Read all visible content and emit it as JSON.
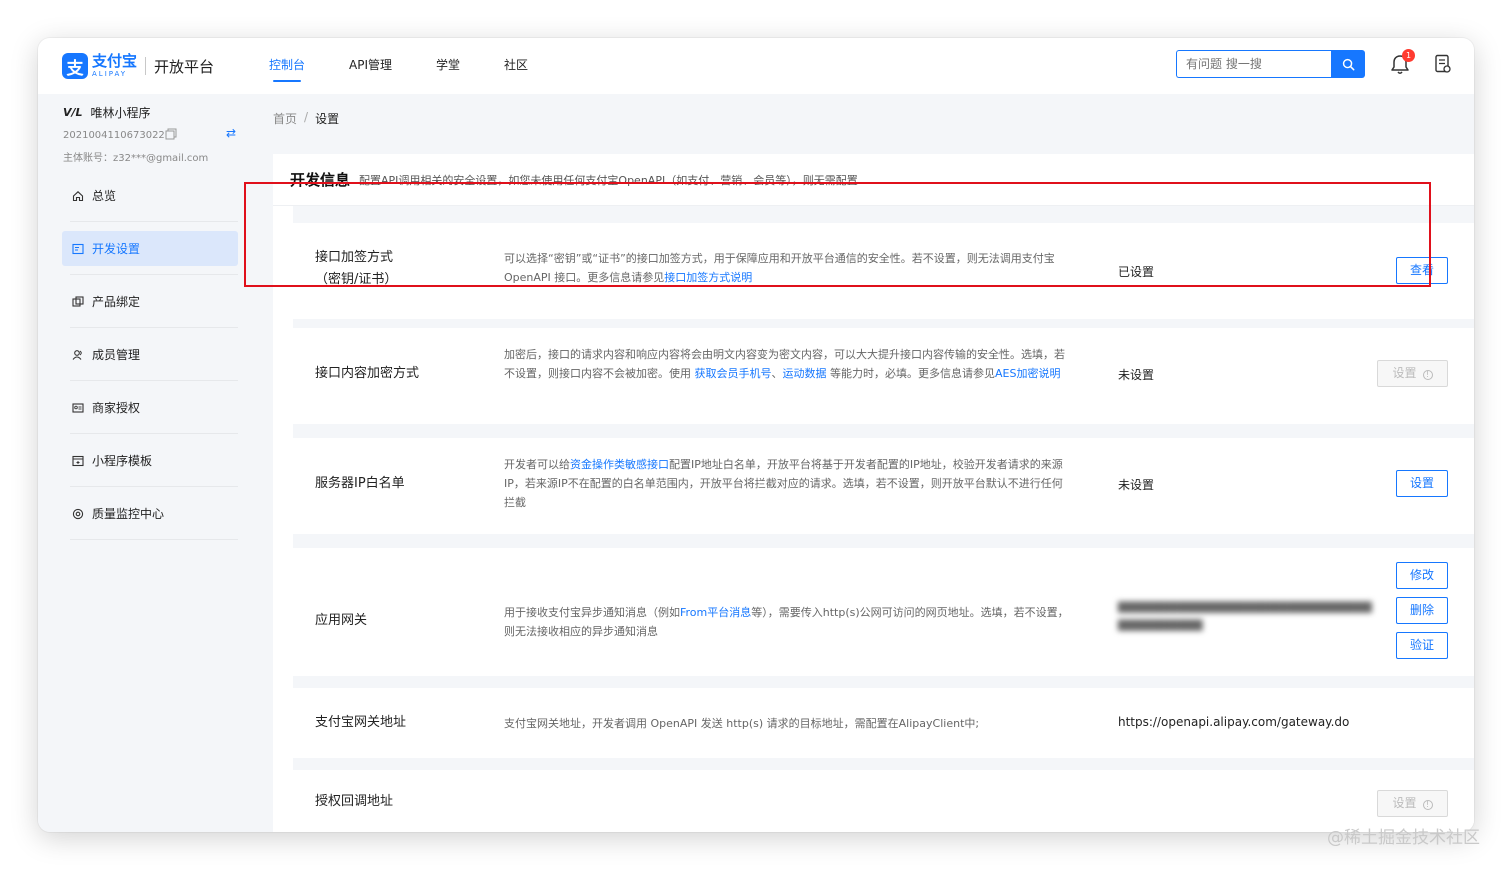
{
  "header": {
    "logo_cn": "支付宝",
    "logo_en": "ALIPAY",
    "platform": "开放平台",
    "nav": [
      "控制台",
      "API管理",
      "学堂",
      "社区"
    ],
    "search_placeholder": "有问题 搜一搜",
    "notification_count": "1"
  },
  "sidebar": {
    "app_name": "唯林小程序",
    "app_id": "2021004110673022",
    "account": "主体账号：z32***@gmail.com",
    "menu": [
      {
        "label": "总览",
        "icon": "home-icon"
      },
      {
        "label": "开发设置",
        "icon": "dev-settings-icon"
      },
      {
        "label": "产品绑定",
        "icon": "product-icon"
      },
      {
        "label": "成员管理",
        "icon": "members-icon"
      },
      {
        "label": "商家授权",
        "icon": "merchant-icon"
      },
      {
        "label": "小程序模板",
        "icon": "template-icon"
      },
      {
        "label": "质量监控中心",
        "icon": "quality-icon"
      }
    ]
  },
  "breadcrumb": {
    "home": "首页",
    "sep": "/",
    "current": "设置"
  },
  "panel": {
    "title": "开发信息",
    "desc": "配置API调用相关的安全设置，如您未使用任何支付宝OpenAPI（如支付、营销、会员等），则无需配置"
  },
  "rows": [
    {
      "name1": "接口加签方式",
      "name2": "（密钥/证书）",
      "desc_a": "可以选择“密钥”或“证书”的接口加签方式，用于保障应用和开放平台通信的安全性。若不设置，则无法调用支付宝 OpenAPI 接口。更多信息请参见",
      "desc_link": "接口加签方式说明",
      "status": "已设置",
      "button": "查看"
    },
    {
      "name": "接口内容加密方式",
      "desc_a": "加密后，接口的请求内容和响应内容将会由明文内容变为密文内容，可以大大提升接口内容传输的安全性。选填，若不设置，则接口内容不会被加密。使用 ",
      "desc_link1": "获取会员手机号",
      "desc_sep": "、",
      "desc_link2": "运动数据",
      "desc_b": " 等能力时，必填。更多信息请参见",
      "desc_link3": "AES加密说明",
      "status": "未设置",
      "button": "设置"
    },
    {
      "name": "服务器IP白名单",
      "desc_a": "开发者可以给",
      "desc_link": "资金操作类敏感接口",
      "desc_b": "配置IP地址白名单，开放平台将基于开发者配置的IP地址，校验开发者请求的来源IP，若来源IP不在配置的白名单范围内，开放平台将拦截对应的请求。选填，若不设置，则开放平台默认不进行任何拦截",
      "status": "未设置",
      "button": "设置"
    },
    {
      "name": "应用网关",
      "desc_a": "用于接收支付宝异步通知消息（例如",
      "desc_link": "From平台消息",
      "desc_b": "等），需要传入http(s)公网可访问的网页地址。选填，若不设置，则无法接收相应的异步通知消息",
      "buttons": [
        "修改",
        "删除",
        "验证"
      ]
    },
    {
      "name": "支付宝网关地址",
      "desc": "支付宝网关地址，开发者调用 OpenAPI 发送 http(s) 请求的目标地址，需配置在AlipayClient中;",
      "status": "https://openapi.alipay.com/gateway.do"
    },
    {
      "name": "授权回调地址",
      "button": "设置"
    }
  ],
  "watermark": "@稀土掘金技术社区",
  "colors": {
    "brand": "#1677ff",
    "highlight": "#e0101b",
    "badge": "#ff3b30"
  }
}
